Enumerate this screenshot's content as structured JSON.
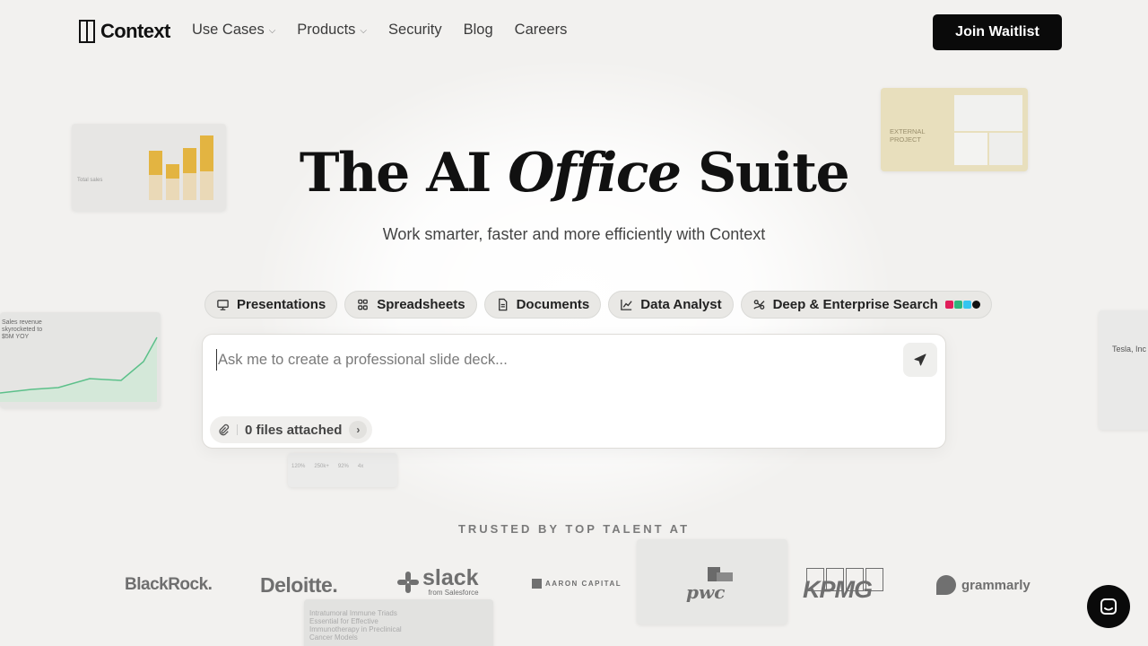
{
  "nav": {
    "logo_text": "Context",
    "links": [
      {
        "label": "Use Cases",
        "dropdown": true
      },
      {
        "label": "Products",
        "dropdown": true
      },
      {
        "label": "Security",
        "dropdown": false
      },
      {
        "label": "Blog",
        "dropdown": false
      },
      {
        "label": "Careers",
        "dropdown": false
      }
    ],
    "cta_label": "Join Waitlist"
  },
  "hero": {
    "title_pre": "The AI ",
    "title_em": "Office",
    "title_post": " Suite",
    "subtitle": "Work smarter, faster and more efficiently with Context"
  },
  "pills": [
    {
      "label": "Presentations",
      "icon": "presentation-icon"
    },
    {
      "label": "Spreadsheets",
      "icon": "spreadsheet-icon"
    },
    {
      "label": "Documents",
      "icon": "document-icon"
    },
    {
      "label": "Data Analyst",
      "icon": "chart-icon"
    },
    {
      "label": "Deep & Enterprise Search",
      "icon": "search-network-icon"
    }
  ],
  "prompt": {
    "placeholder": "Ask me to create a professional slide deck...",
    "value": "",
    "files_label": "0 files attached"
  },
  "trusted": {
    "heading": "TRUSTED BY TOP TALENT AT",
    "logos": [
      "BlackRock.",
      "Deloitte.",
      "slack",
      "from Salesforce",
      "AARON CAPITAL",
      "pwc",
      "KPMG",
      "grammarly"
    ]
  },
  "deco_cards": {
    "card1_label": "Total sales",
    "card2_line1": "EXTERNAL",
    "card2_line2": "PROJECT",
    "card3_line1": "Sales revenue",
    "card3_line2": "skyrocketed to",
    "card3_line3": "$5M YOY",
    "card4_line1": "Tesla, Inc",
    "card5_values": [
      "120%",
      "250k+",
      "92%",
      "4x"
    ],
    "card7_line1": "Intratumoral Immune Triads",
    "card7_line2": "Essential for Effective",
    "card7_line3": "Immunotherapy in Preclinical",
    "card7_line4": "Cancer Models"
  },
  "colors": {
    "background": "#f2f1ef",
    "accent_black": "#0a0a0a",
    "chart_yellow": "#e3b441"
  }
}
